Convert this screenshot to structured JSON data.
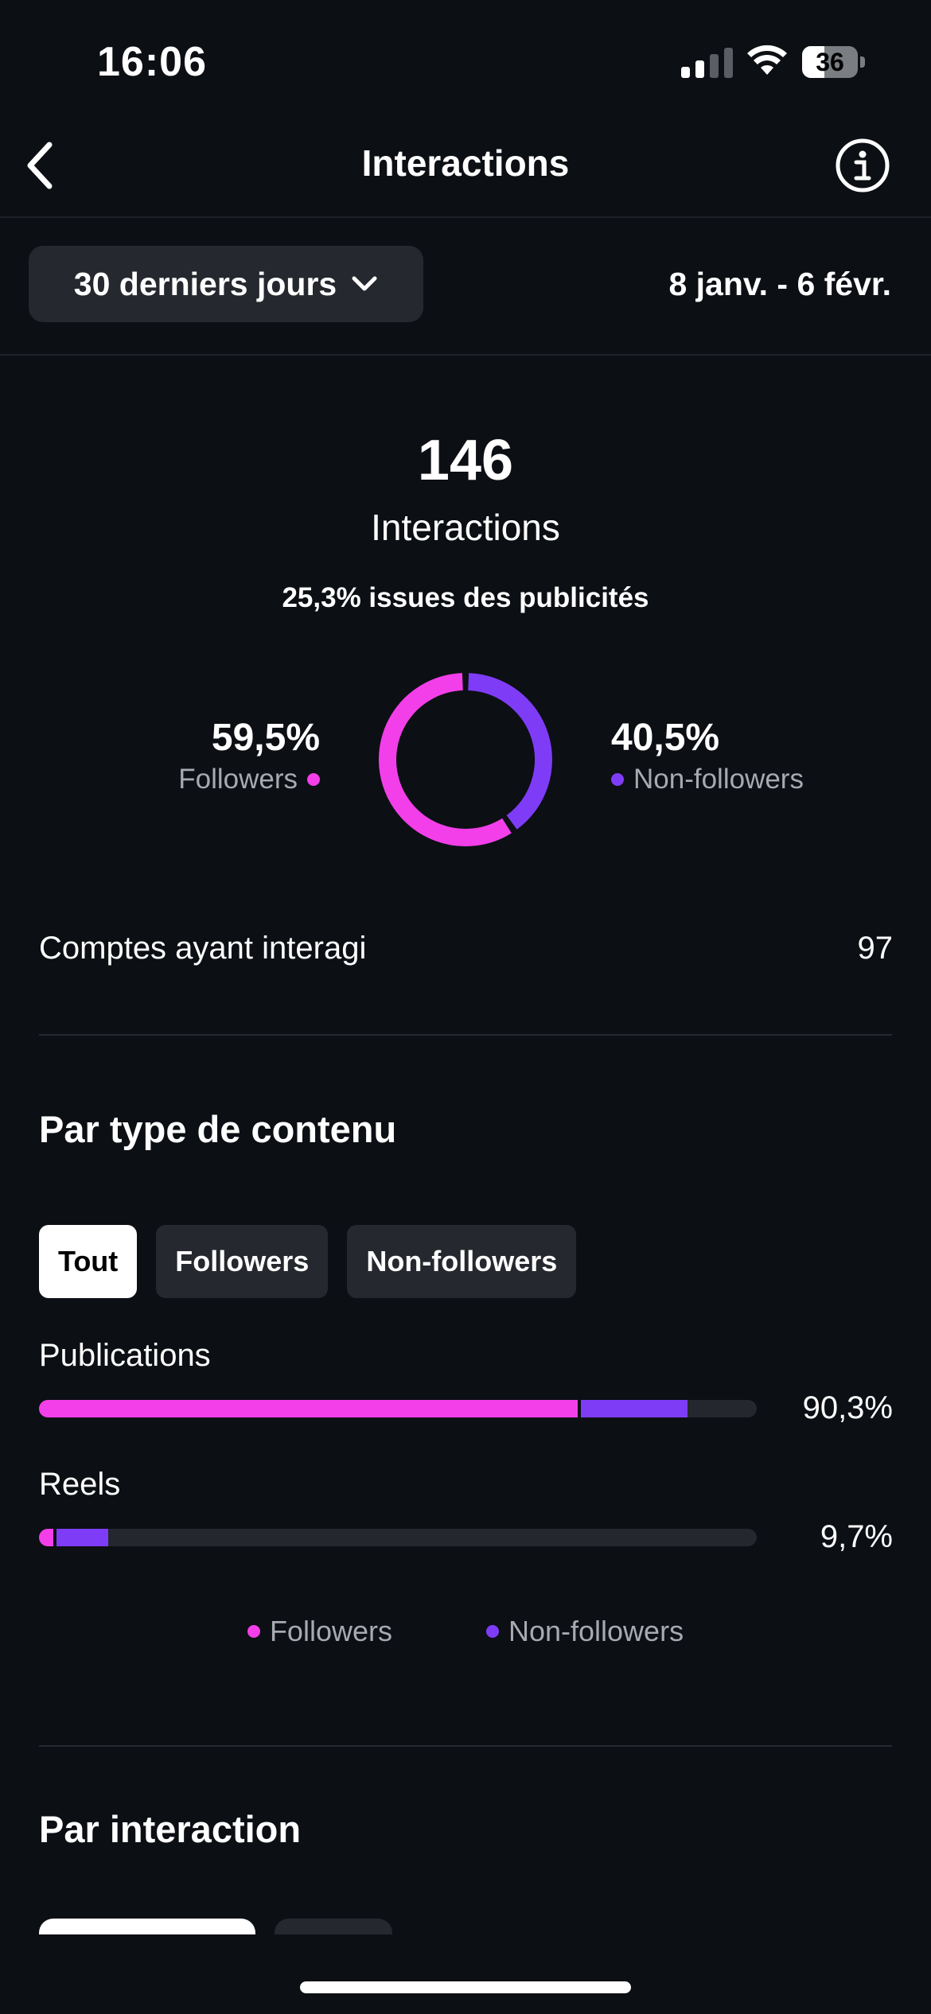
{
  "status_bar": {
    "time": "16:06",
    "battery": "36"
  },
  "header": {
    "title": "Interactions"
  },
  "filter": {
    "period_label": "30 derniers jours",
    "date_range": "8 janv. - 6 févr."
  },
  "summary": {
    "total": "146",
    "label": "Interactions",
    "ads_share": "25,3% issues des publicités",
    "followers_pct": "59,5%",
    "followers_label": "Followers",
    "non_followers_pct": "40,5%",
    "non_followers_label": "Non-followers",
    "followers_fraction": 0.595,
    "non_followers_fraction": 0.405
  },
  "accounts": {
    "label": "Comptes ayant interagi",
    "value": "97"
  },
  "content_type": {
    "title": "Par type de contenu",
    "tabs": [
      {
        "label": "Tout",
        "active": true
      },
      {
        "label": "Followers",
        "active": false
      },
      {
        "label": "Non-followers",
        "active": false
      }
    ],
    "bars": [
      {
        "label": "Publications",
        "pct": "90,3%",
        "followers_fraction": 0.75,
        "non_followers_fraction": 0.153
      },
      {
        "label": "Reels",
        "pct": "9,7%",
        "followers_fraction": 0.02,
        "non_followers_fraction": 0.077
      }
    ],
    "legend": {
      "followers": "Followers",
      "non_followers": "Non-followers"
    }
  },
  "by_interaction": {
    "title": "Par interaction"
  },
  "colors": {
    "followers": "#f23fe9",
    "non_followers": "#7f3cf6",
    "background": "#0c0f14"
  }
}
